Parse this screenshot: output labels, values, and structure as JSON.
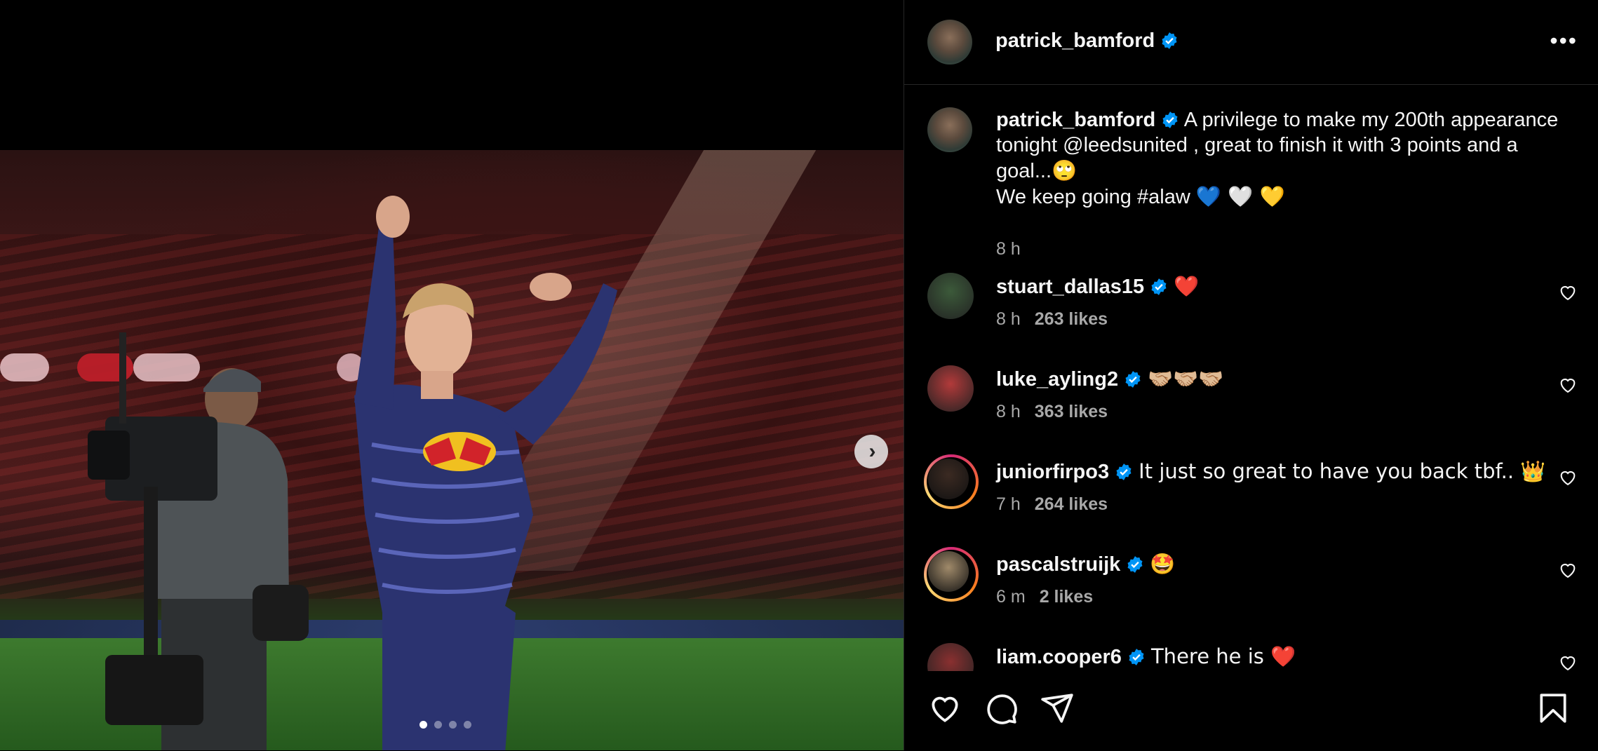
{
  "post": {
    "author": "patrick_bamford",
    "caption_line1": "A privilege to make my 200th appearance tonight @leedsunited , great to finish it with 3 points and a goal...",
    "caption_emoji1": "🙄",
    "caption_line2": "We keep going #alaw",
    "caption_emoji2": "💙 🤍 💛",
    "time": "8 h"
  },
  "comments": [
    {
      "user": "stuart_dallas15",
      "text": "❤️",
      "time": "8 h",
      "likes": "263 likes",
      "story": false,
      "avatar_color": "#3c5a3a"
    },
    {
      "user": "luke_ayling2",
      "text": "🤝🏼🤝🏼🤝🏼",
      "time": "8 h",
      "likes": "363 likes",
      "story": false,
      "avatar_color": "#b23a3a"
    },
    {
      "user": "juniorfirpo3",
      "text": "It just so great to have you back tbf.. 👑",
      "time": "7 h",
      "likes": "264 likes",
      "story": true,
      "avatar_color": "#3b2a22"
    },
    {
      "user": "pascalstruijk",
      "text": "🤩",
      "time": "6 m",
      "likes": "2 likes",
      "story": true,
      "avatar_color": "#a08a6a"
    },
    {
      "user": "liam.cooper6",
      "text": "There he is ❤️",
      "time": "",
      "likes": "",
      "story": false,
      "avatar_color": "#8a3030"
    }
  ],
  "carousel": {
    "count": 4,
    "active": 0
  },
  "icons": {
    "more": "more-options-icon",
    "verified": "verified-badge-icon",
    "next": "chevron-right-icon",
    "like": "heart-icon",
    "comment": "comment-icon",
    "share": "share-icon",
    "save": "bookmark-icon"
  },
  "colors": {
    "verified": "#0095f6",
    "background": "#000000",
    "secondary_text": "#a8a8a8"
  }
}
